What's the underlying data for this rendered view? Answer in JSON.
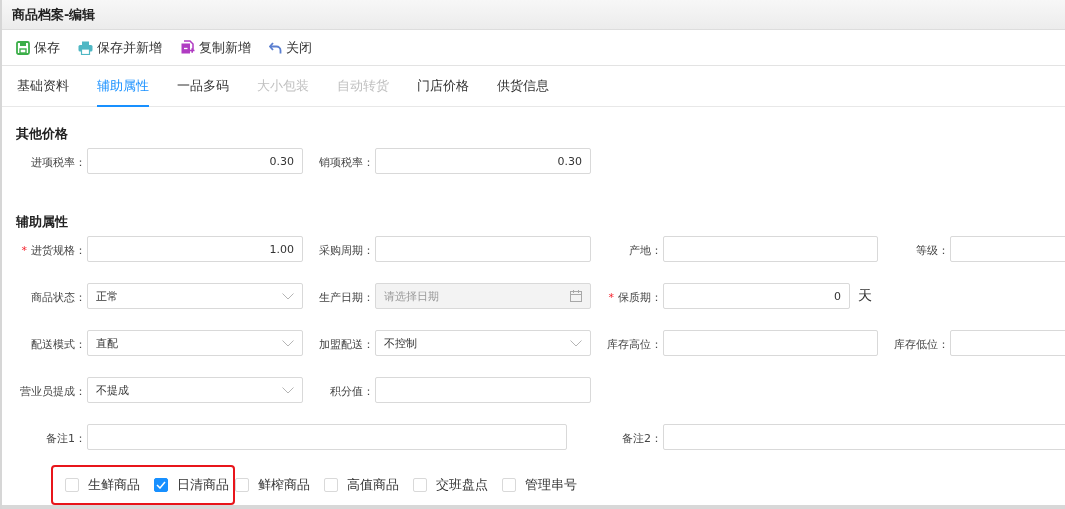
{
  "window": {
    "title": "商品档案-编辑"
  },
  "toolbar": [
    {
      "label": "保存",
      "kind": "save"
    },
    {
      "label": "保存并新增",
      "kind": "print"
    },
    {
      "label": "复制新增",
      "kind": "copy"
    },
    {
      "label": "关闭",
      "kind": "undo"
    }
  ],
  "tabs": [
    {
      "label": "基础资料",
      "selected": false,
      "disabled": false
    },
    {
      "label": "辅助属性",
      "selected": true,
      "disabled": false
    },
    {
      "label": "一品多码",
      "selected": false,
      "disabled": false
    },
    {
      "label": "大小包装",
      "selected": false,
      "disabled": true
    },
    {
      "label": "自动转货",
      "selected": false,
      "disabled": true
    },
    {
      "label": "门店价格",
      "selected": false,
      "disabled": false
    },
    {
      "label": "供货信息",
      "selected": false,
      "disabled": false
    }
  ],
  "sections": [
    {
      "title": "其他价格",
      "rows": [
        [
          {
            "label": "进项税率：",
            "kind": "number",
            "value": "0.30"
          },
          {
            "label": "销项税率：",
            "kind": "number",
            "value": "0.30"
          }
        ]
      ]
    },
    {
      "title": "辅助属性",
      "rows": [
        [
          {
            "required_mark": "*",
            "label": "进货规格：",
            "kind": "number",
            "value": "1.00"
          },
          {
            "label": "采购周期：",
            "kind": "text"
          },
          {
            "label": "产地：",
            "kind": "text"
          },
          {
            "label": "等级：",
            "kind": "text"
          }
        ],
        [
          {
            "label": "商品状态：",
            "kind": "select",
            "value": "正常"
          },
          {
            "label": "生产日期：",
            "kind": "date",
            "placeholder": "请选择日期",
            "disabled": true
          },
          {
            "required_mark": "*",
            "label": "保质期：",
            "kind": "number",
            "value": "0",
            "unit": "天"
          }
        ],
        [
          {
            "label": "配送模式：",
            "kind": "select",
            "value": "直配"
          },
          {
            "label": "加盟配送：",
            "kind": "select",
            "value": "不控制"
          },
          {
            "label": "库存高位：",
            "kind": "text"
          },
          {
            "label": "库存低位：",
            "kind": "text"
          }
        ],
        [
          {
            "label": "营业员提成：",
            "kind": "select",
            "value": "不提成"
          },
          {
            "label": "积分值：",
            "kind": "text"
          }
        ],
        [
          {
            "label": "备注1：",
            "kind": "long_text"
          },
          "",
          {
            "label": "备注2：",
            "kind": "long_text"
          }
        ]
      ]
    }
  ],
  "checkbox_groups": [
    {
      "highlighted": true,
      "items": [
        {
          "label": "生鲜商品",
          "checked": false
        },
        {
          "label": "日清商品",
          "checked": true
        }
      ]
    },
    {
      "highlighted": false,
      "items": [
        {
          "label": "鲜榨商品",
          "checked": false
        },
        {
          "label": "高值商品",
          "checked": false
        },
        {
          "label": "交班盘点",
          "checked": false
        },
        {
          "label": "管理串号",
          "checked": false
        }
      ]
    }
  ]
}
